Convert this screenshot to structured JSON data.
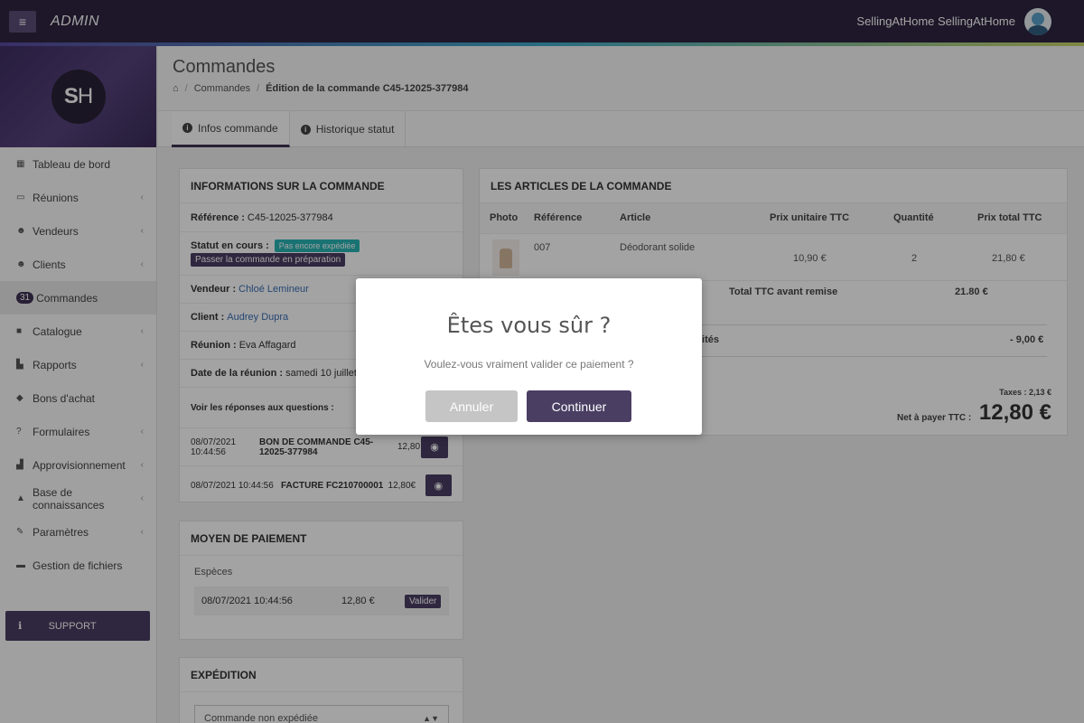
{
  "topbar": {
    "brand": "ADMIN",
    "menu_icon": "hamburger-icon",
    "user_name": "SellingAtHome SellingAtHome"
  },
  "sidebar": {
    "logo_text": "SH",
    "items": [
      {
        "label": "Tableau de bord",
        "icon": "dashboard-icon"
      },
      {
        "label": "Réunions",
        "icon": "calendar-icon"
      },
      {
        "label": "Vendeurs",
        "icon": "users-icon"
      },
      {
        "label": "Clients",
        "icon": "users-icon"
      },
      {
        "label": "Commandes",
        "badge": "31"
      },
      {
        "label": "Catalogue",
        "icon": "book-icon"
      },
      {
        "label": "Rapports",
        "icon": "chart-icon"
      },
      {
        "label": "Bons d'achat",
        "icon": "tag-icon"
      },
      {
        "label": "Formulaires",
        "icon": "question-icon"
      },
      {
        "label": "Approvisionnement",
        "icon": "factory-icon"
      },
      {
        "label": "Base de connaissances",
        "icon": "graduation-icon"
      },
      {
        "label": "Paramètres",
        "icon": "wrench-icon"
      },
      {
        "label": "Gestion de fichiers",
        "icon": "folder-icon"
      }
    ],
    "support_label": "SUPPORT"
  },
  "header": {
    "title": "Commandes",
    "breadcrumb": {
      "home_icon": "home-icon",
      "level1": "Commandes",
      "current": "Édition de la commande C45-12025-377984"
    },
    "tabs": [
      {
        "label": "Infos commande",
        "active": true
      },
      {
        "label": "Historique statut",
        "active": false
      }
    ]
  },
  "order_info": {
    "title": "INFORMATIONS SUR LA COMMANDE",
    "reference_label": "Référence :",
    "reference_value": "C45-12025-377984",
    "status_label": "Statut en cours :",
    "status_value": "Pas encore expédiée",
    "status_action": "Passer la commande en préparation",
    "seller_label": "Vendeur :",
    "seller_value": "Chloé Lemineur",
    "client_label": "Client :",
    "client_value": "Audrey Dupra",
    "meeting_label": "Réunion :",
    "meeting_value": "Eva Affagard",
    "meeting_date_label": "Date de la réunion :",
    "meeting_date_value": "samedi 10 juillet",
    "answers_label": "Voir les réponses aux questions :",
    "documents": [
      {
        "date": "08/07/2021 10:44:56",
        "name": "BON DE COMMANDE C45-12025-377984",
        "amount": "12,80"
      },
      {
        "date": "08/07/2021 10:44:56",
        "name": "FACTURE FC210700001",
        "amount": "12,80€"
      }
    ]
  },
  "payment": {
    "title": "MOYEN DE PAIEMENT",
    "method": "Espèces",
    "date": "08/07/2021 10:44:56",
    "amount": "12,80 €",
    "validate_label": "Valider"
  },
  "shipping": {
    "title": "EXPÉDITION",
    "select_value": "Commande non expédiée"
  },
  "articles": {
    "title": "LES ARTICLES DE LA COMMANDE",
    "columns": [
      "Photo",
      "Référence",
      "Article",
      "Prix unitaire TTC",
      "Quantité",
      "Prix total TTC"
    ],
    "rows": [
      {
        "reference": "007",
        "article": "Déodorant solide",
        "unit_price": "10,90 €",
        "quantity": "2",
        "total": "21,80 €"
      }
    ],
    "subtotal_label": "Total TTC avant remise",
    "subtotal_value": "21.80 €",
    "discount_label": "lités",
    "discount_value": "- 9,00 €",
    "taxes": "Taxes : 2,13 €",
    "net_label": "Net à payer TTC :",
    "net_value": "12,80 €"
  },
  "modal": {
    "title": "Êtes vous sûr ?",
    "text": "Voulez-vous vraiment valider ce paiement ?",
    "cancel_label": "Annuler",
    "continue_label": "Continuer"
  },
  "colors": {
    "primary": "#4a3e63",
    "topbar": "#2e2540",
    "status_tag": "#2ab5b5",
    "link": "#3a6fb5"
  }
}
